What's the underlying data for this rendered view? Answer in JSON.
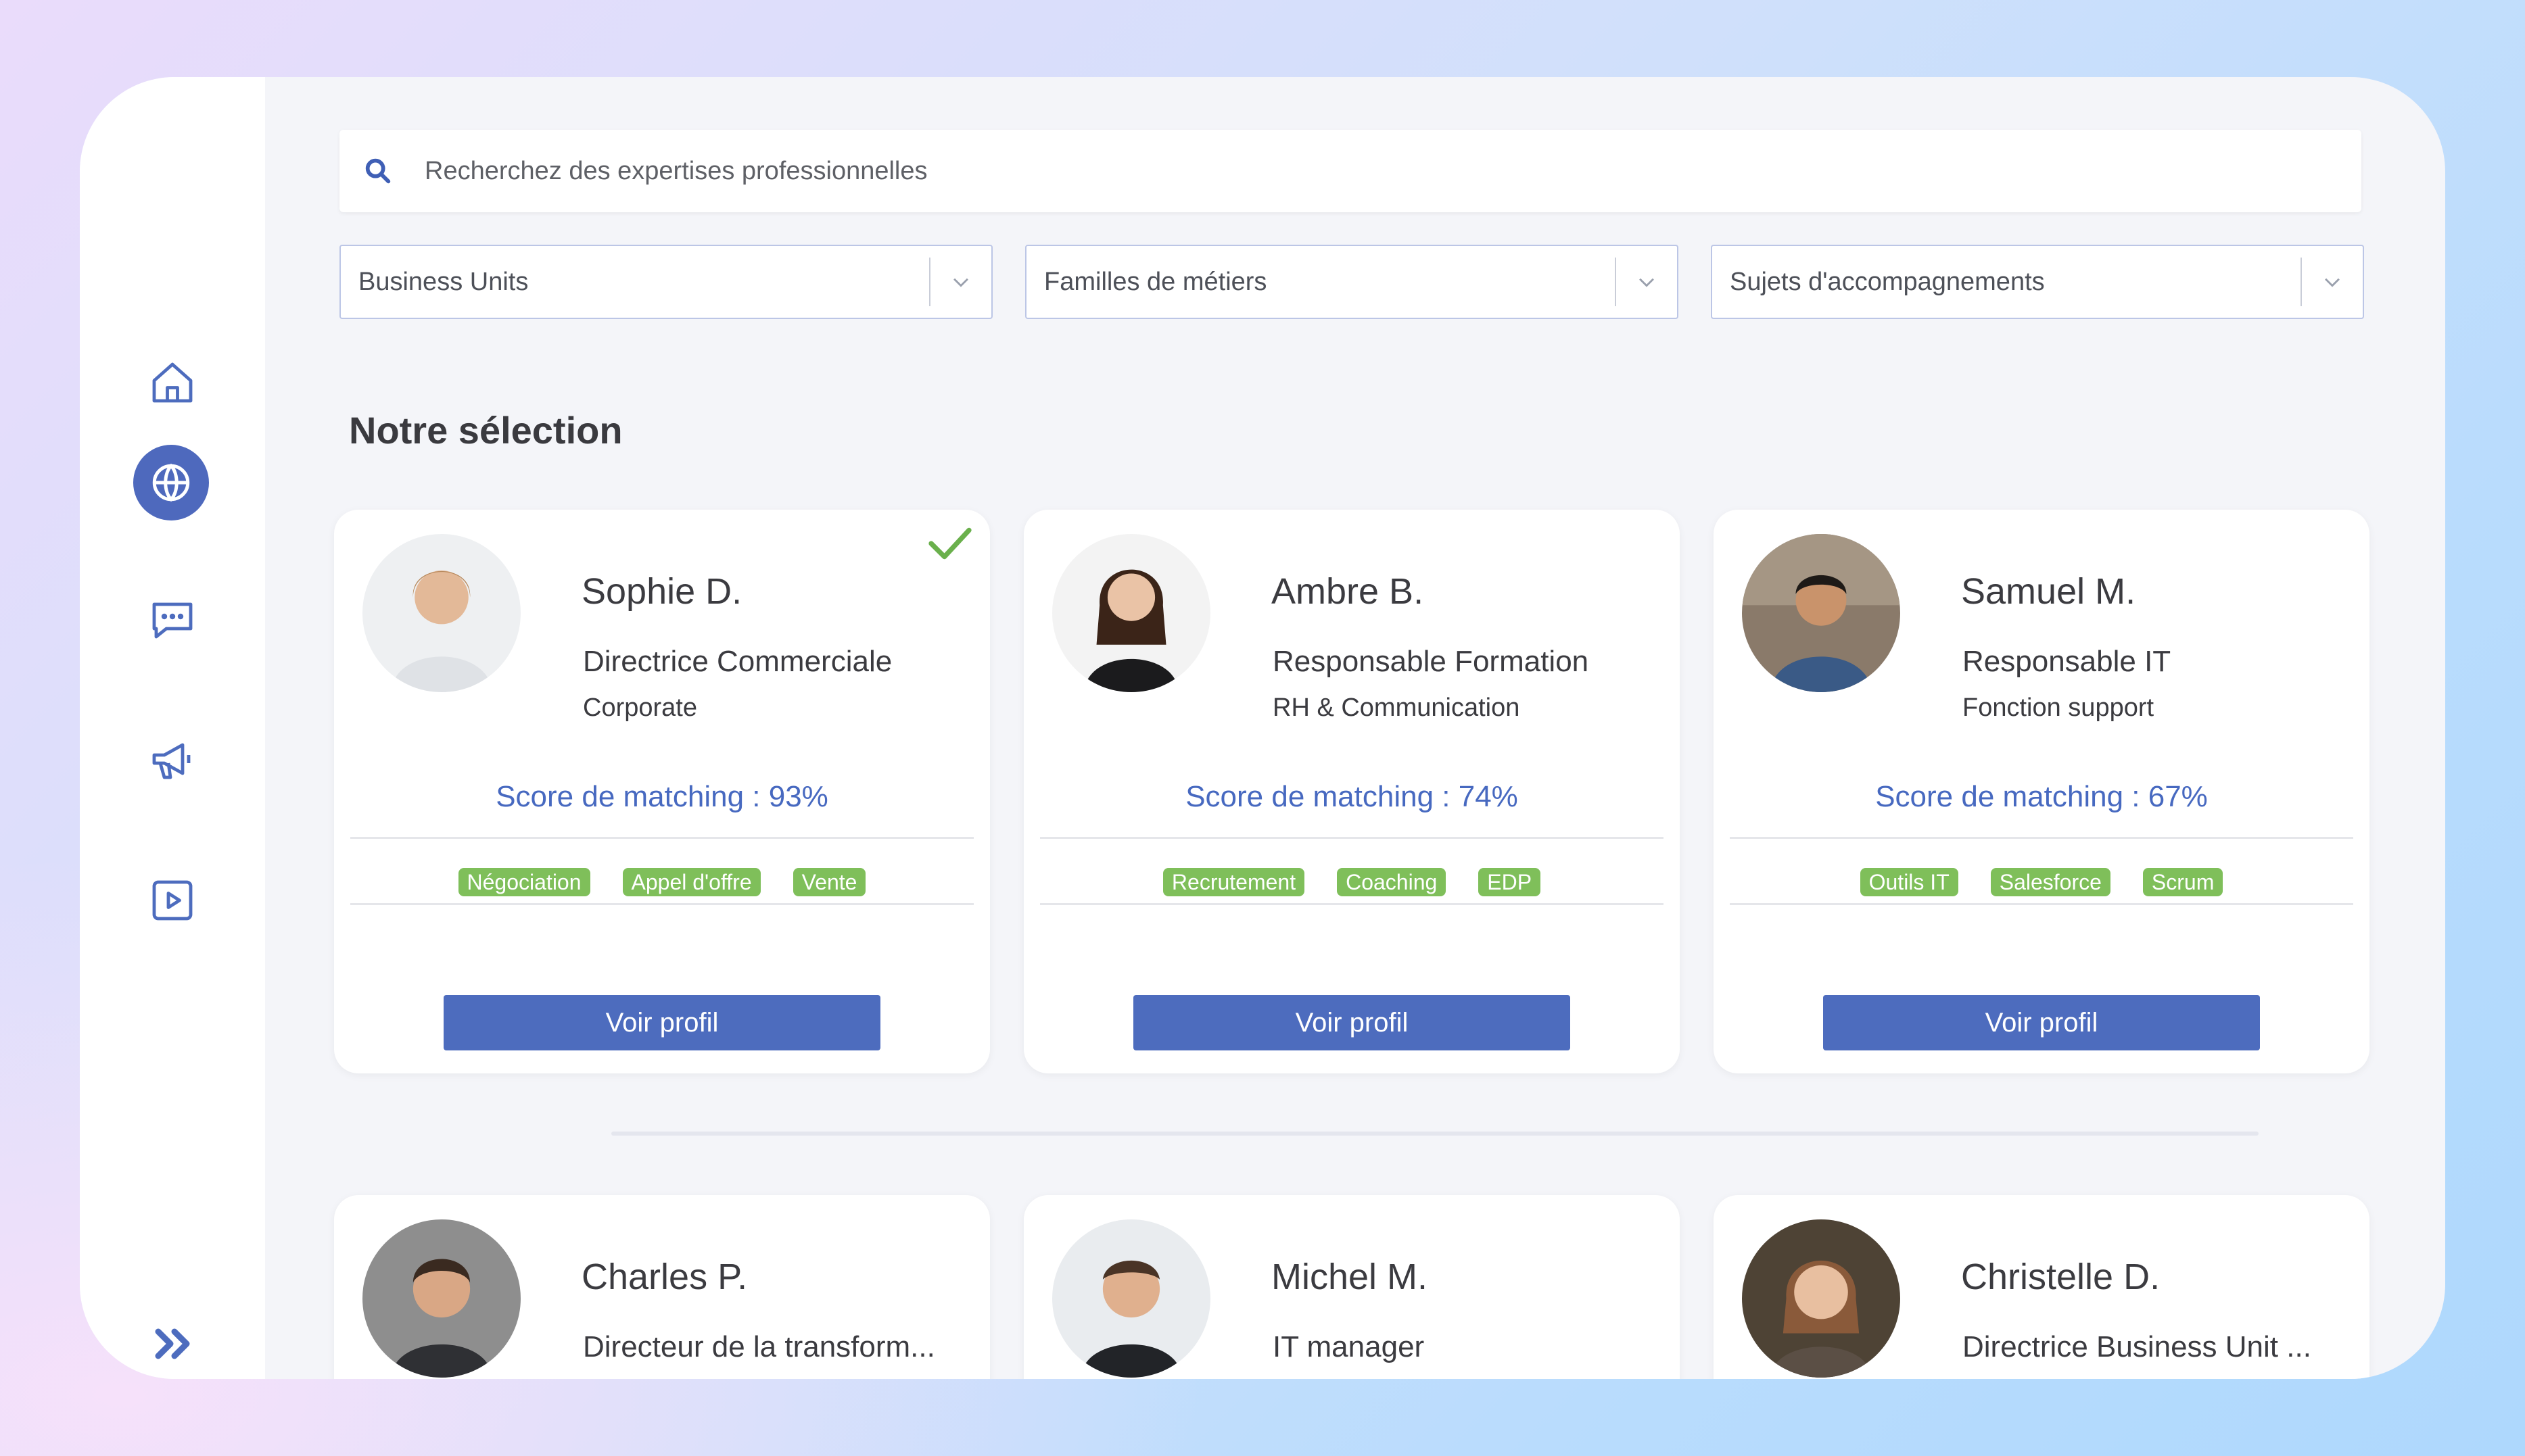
{
  "search": {
    "placeholder": "Recherchez des expertises professionnelles"
  },
  "filters": [
    {
      "label": "Business Units"
    },
    {
      "label": "Familles de métiers"
    },
    {
      "label": "Sujets d'accompagnements"
    }
  ],
  "section_title": "Notre sélection",
  "sidebar": {
    "items": [
      {
        "icon": "home-icon",
        "active": false
      },
      {
        "icon": "globe-icon",
        "active": true
      },
      {
        "icon": "chat-icon",
        "active": false
      },
      {
        "icon": "megaphone-icon",
        "active": false
      },
      {
        "icon": "play-icon",
        "active": false
      }
    ],
    "expand_icon": "double-chevron-right-icon"
  },
  "colors": {
    "accent": "#4d6cbe",
    "tag": "#7fbf5a",
    "score": "#4769c0",
    "check": "#6ab04c"
  },
  "cards": [
    {
      "name": "Sophie D.",
      "role": "Directrice Commerciale",
      "unit": "Corporate",
      "score": "Score de matching : 93%",
      "tags": [
        "Négociation",
        "Appel d'offre",
        "Vente"
      ],
      "button": "Voir profil",
      "selected": true
    },
    {
      "name": "Ambre B.",
      "role": "Responsable Formation",
      "unit": "RH & Communication",
      "score": "Score de matching : 74%",
      "tags": [
        "Recrutement",
        "Coaching",
        "EDP"
      ],
      "button": "Voir profil",
      "selected": false
    },
    {
      "name": "Samuel M.",
      "role": "Responsable IT",
      "unit": "Fonction support",
      "score": "Score de matching : 67%",
      "tags": [
        "Outils IT",
        "Salesforce",
        "Scrum"
      ],
      "button": "Voir profil",
      "selected": false
    },
    {
      "name": "Charles P.",
      "role": "Directeur de la transform..."
    },
    {
      "name": "Michel M.",
      "role": "IT manager"
    },
    {
      "name": "Christelle D.",
      "role": "Directrice Business Unit ..."
    }
  ]
}
